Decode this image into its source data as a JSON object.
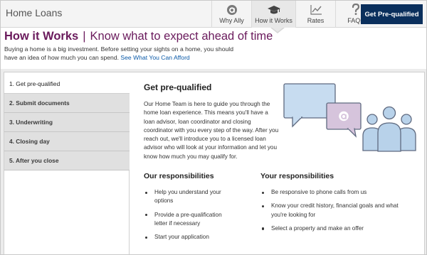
{
  "header": {
    "brand": "Home Loans",
    "nav": [
      {
        "label": "Why Ally",
        "icon": "ally-logo-icon"
      },
      {
        "label": "How it Works",
        "icon": "graduation-cap-icon"
      },
      {
        "label": "Rates",
        "icon": "line-chart-icon"
      },
      {
        "label": "FAQs",
        "icon": "question-mark-icon"
      }
    ],
    "active_nav": "How it Works",
    "cta_label": "Get Pre-qualified"
  },
  "page": {
    "title": "How it Works",
    "subtitle": "Know what to expect ahead of time",
    "intro": "Buying a home is a big investment. Before setting your sights on a home, you should have an idea of how much you can spend.",
    "intro_link": "See What You Can Afford"
  },
  "steps": [
    {
      "label": "1. Get pre-qualified",
      "active": true
    },
    {
      "label": "2. Submit documents",
      "active": false
    },
    {
      "label": "3. Underwriting",
      "active": false
    },
    {
      "label": "4. Closing day",
      "active": false
    },
    {
      "label": "5. After you close",
      "active": false
    }
  ],
  "content": {
    "heading": "Get pre-qualified",
    "body": "Our Home Team is here to guide you through the home loan experience. This means you'll have a loan advisor, loan coordinator and closing coordinator with you every step of the way. After you reach out, we'll introduce you to a licensed loan advisor who will look at your information and let you know how much you may qualify for.",
    "illustration": "chat-bubbles-people-illustration",
    "our_title": "Our responsibilities",
    "ours": [
      "Help you understand your options",
      "Provide a pre-qualification letter if necessary",
      "Start your application"
    ],
    "your_title": "Your responsibilities",
    "yours": [
      "Be responsive to phone calls from us",
      "Know your credit history, financial goals and what you're looking for",
      "Select a property and make an offer"
    ]
  },
  "colors": {
    "headline": "#6a1a5c",
    "cta": "#0a2f5c",
    "link": "#0b5aa8",
    "bubble_blue": "#c7dcf0",
    "bubble_purple": "#d6c4dc",
    "people": "#b8d2ea"
  }
}
